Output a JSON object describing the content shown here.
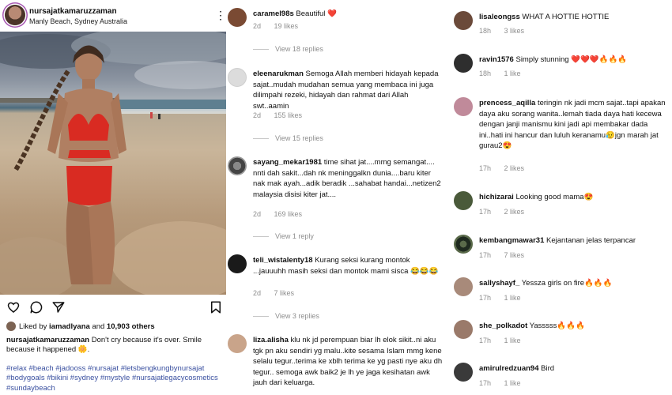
{
  "post": {
    "username": "nursajatkamaruzzaman",
    "location": "Manly Beach, Sydney Australia",
    "liked_by_user": "iamadlyana",
    "liked_by_others": "10,903 others",
    "liked_prefix": "Liked by",
    "liked_and": "and",
    "caption_user": "nursajatkamaruzzaman",
    "caption_text": "Don't cry because it's over. Smile because it happened 🌼.",
    "hashtags": "#relax #beach #jadooss #nursajat #letsbengkungbynursajat #bodygoals #bikini #sydney #mystyle #nursajatlegacycosmetics #sundaybeach",
    "icons": [
      "more-icon",
      "heart-icon",
      "comment-icon",
      "share-icon",
      "save-icon"
    ]
  },
  "comments_mid": [
    {
      "user": "caramel98s",
      "text": "Beautiful ❤️",
      "time": "2d",
      "likes": "19 likes",
      "replies": "View 18 replies",
      "color": "#7a4a33"
    },
    {
      "user": "eleenarukman",
      "text": "Semoga Allah memberi hidayah kepada sajat..mudah mudahan semua yang membaca ini juga dilimpahi rezeki, hidayah dan rahmat dari Allah swt..aamin",
      "time": "2d",
      "likes": "155 likes",
      "replies": "View 15 replies",
      "color": "#d9d9d9"
    },
    {
      "user": "sayang_mekar1981",
      "text": "time sihat jat....mmg semangat.... nnti dah sakit...dah nk meninggalkn dunia....baru kiter nak mak ayah...adik beradik ...sahabat handai...netizen2 malaysia disisi kiter jat....",
      "time": "2d",
      "likes": "169 likes",
      "replies": "View 1 reply",
      "color": "#5a5a5a"
    },
    {
      "user": "teli_wistalenty18",
      "text": "Kurang  seksi  kurang montok ...jauuuhh  masih  seksi  dan montok mami  sisca 😂😂😂",
      "time": "2d",
      "likes": "7 likes",
      "replies": "View 3 replies",
      "color": "#1a1a1a"
    },
    {
      "user": "liza.alisha",
      "text": "klu nk jd perempuan biar lh elok sikit..ni aku tgk pn aku sendiri yg malu..kite sesama Islam mmg kene selalu tegur..terima ke xblh terima ke yg pasti nye aku dh tegur.. semoga awk baik2 je lh ye jaga kesihatan awk jauh dari keluarga.",
      "color": "#c9a48a"
    }
  ],
  "comments_right": [
    {
      "user": "lisaleongss",
      "text": "WHAT A HOTTIE HOTTIE",
      "time": "18h",
      "likes": "3 likes",
      "color": "#6b4a3a"
    },
    {
      "user": "ravin1576",
      "text": "Simply stunning ❤️❤️❤️🔥🔥🔥",
      "time": "18h",
      "likes": "1 like",
      "color": "#2e2e2e"
    },
    {
      "user": "prencess_aqilla",
      "text": "teringin nk jadi mcm sajat..tapi apakan daya aku sorang wanita..lemah tiada daya hati kecewa dengan janji manismu kini jadi api membakar dada ini..hati ini hancur dan luluh keranamu😥jgn marah jat gurau2😍",
      "time": "17h",
      "likes": "2 likes",
      "color": "#c08a9a"
    },
    {
      "user": "hichizarai",
      "text": "Looking good mama😍",
      "time": "17h",
      "likes": "2 likes",
      "color": "#4a5a3a"
    },
    {
      "user": "kembangmawar31",
      "text": "Kejantanan jelas terpancar",
      "time": "17h",
      "likes": "7 likes",
      "color": "#2b3a2b"
    },
    {
      "user": "sallyshayf_",
      "text": "Yessza girls on fire🔥🔥🔥",
      "time": "17h",
      "likes": "1 like",
      "color": "#a88a7a"
    },
    {
      "user": "she_polkadot",
      "text": "Yasssss🔥🔥🔥",
      "time": "17h",
      "likes": "1 like",
      "color": "#9a7a6a"
    },
    {
      "user": "amirulredzuan94",
      "text": "Bird",
      "time": "17h",
      "likes": "1 like",
      "color": "#3a3a3a"
    }
  ]
}
